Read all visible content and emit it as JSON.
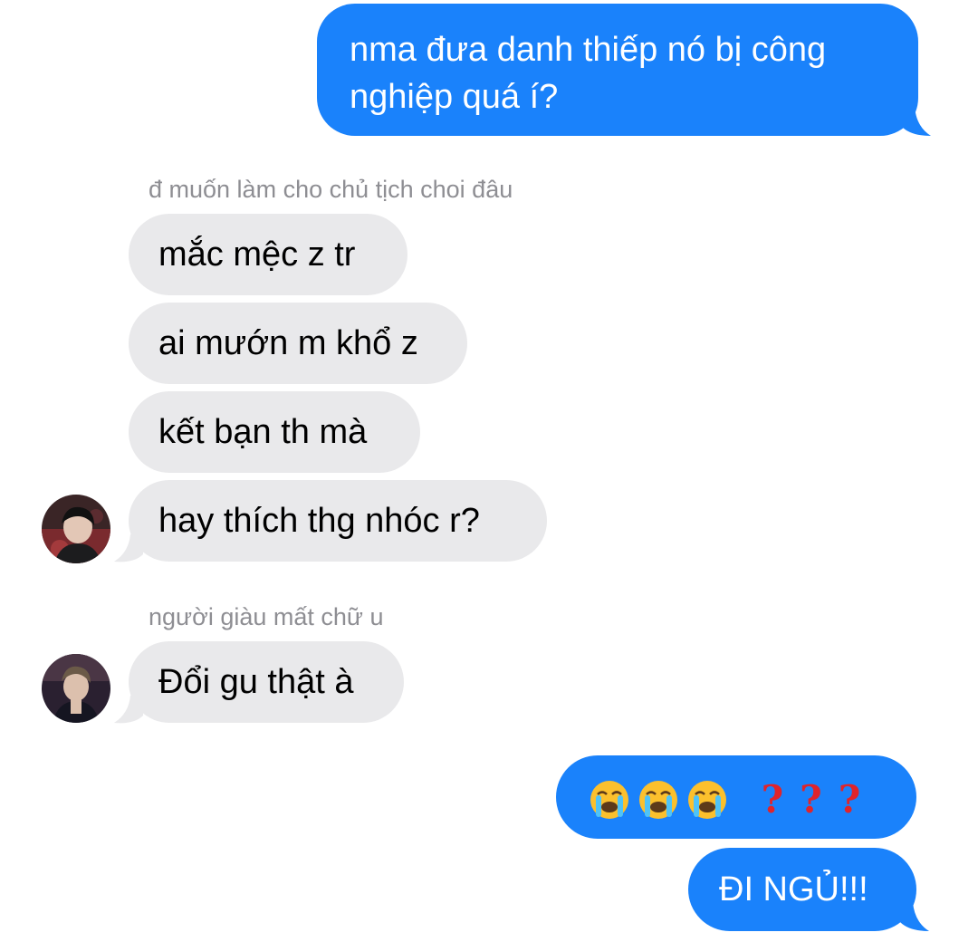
{
  "messages": {
    "m1": {
      "text": "nma đưa danh thiếp nó bị công nghiệp quá í?"
    },
    "label1": "đ muốn làm cho chủ tịch choi đâu",
    "m2": {
      "text": "mắc mệc z tr"
    },
    "m3": {
      "text": "ai mướn m khổ z"
    },
    "m4": {
      "text": "kết bạn th mà"
    },
    "m5": {
      "text": "hay thích thg nhóc r?"
    },
    "label2": "người giàu mất chữ u",
    "m6": {
      "text": "Đổi gu thật à"
    },
    "m7": {
      "emoji_count": 3,
      "emoji_name": "loudly-crying-face",
      "question_marks": [
        "?",
        "?",
        "?"
      ]
    },
    "m8": {
      "text": "ĐI NGỦ!!!"
    }
  },
  "colors": {
    "sent_bubble": "#1a82fb",
    "received_bubble": "#e9e9eb",
    "label": "#8e8e93",
    "red_question": "#e0242a"
  }
}
